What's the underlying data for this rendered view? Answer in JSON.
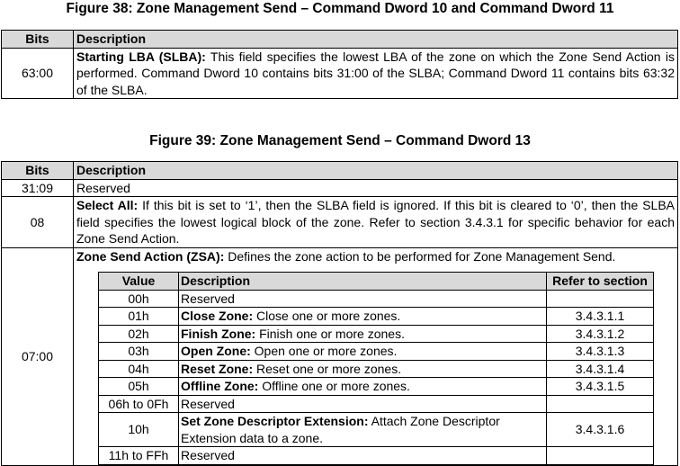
{
  "fig38": {
    "title": "Figure 38: Zone Management Send – Command Dword 10 and Command Dword 11",
    "headers": {
      "bits": "Bits",
      "description": "Description"
    },
    "row": {
      "bits": "63:00",
      "bold": "Starting LBA (SLBA):",
      "text": " This field specifies the lowest LBA of the zone on which the Zone Send Action is performed. Command Dword 10 contains bits 31:00 of the SLBA; Command Dword 11 contains bits 63:32 of the SLBA."
    }
  },
  "fig39": {
    "title": "Figure 39: Zone Management Send – Command Dword 13",
    "headers": {
      "bits": "Bits",
      "description": "Description"
    },
    "row_reserved": {
      "bits": "31:09",
      "text": "Reserved"
    },
    "row_select": {
      "bits": "08",
      "bold": "Select All:",
      "text": " If this bit is set to ‘1’, then the SLBA field is ignored. If this bit is cleared to ‘0’, then the SLBA field specifies the lowest logical block of the zone. Refer to section 3.4.3.1 for specific behavior for each Zone Send Action."
    },
    "row_zsa": {
      "bits": "07:00",
      "bold": "Zone Send Action (ZSA):",
      "text": " Defines the zone action to be performed for Zone Management Send."
    },
    "inner_headers": {
      "value": "Value",
      "description": "Description",
      "ref": "Refer to section"
    },
    "actions": [
      {
        "value": "00h",
        "bold": "",
        "text": "Reserved",
        "ref": ""
      },
      {
        "value": "01h",
        "bold": "Close Zone:",
        "text": " Close one or more zones.",
        "ref": "3.4.3.1.1"
      },
      {
        "value": "02h",
        "bold": "Finish Zone:",
        "text": " Finish one or more zones.",
        "ref": "3.4.3.1.2"
      },
      {
        "value": "03h",
        "bold": "Open Zone:",
        "text": " Open one or more zones.",
        "ref": "3.4.3.1.3"
      },
      {
        "value": "04h",
        "bold": "Reset Zone:",
        "text": " Reset one or more zones.",
        "ref": "3.4.3.1.4"
      },
      {
        "value": "05h",
        "bold": "Offline Zone:",
        "text": " Offline one or more zones.",
        "ref": "3.4.3.1.5"
      },
      {
        "value": "06h to 0Fh",
        "bold": "",
        "text": "Reserved",
        "ref": ""
      },
      {
        "value": "10h",
        "bold": "Set Zone Descriptor Extension:",
        "text": " Attach Zone Descriptor Extension data to a zone.",
        "ref": "3.4.3.1.6"
      },
      {
        "value": "11h to FFh",
        "bold": "",
        "text": "Reserved",
        "ref": ""
      }
    ]
  }
}
